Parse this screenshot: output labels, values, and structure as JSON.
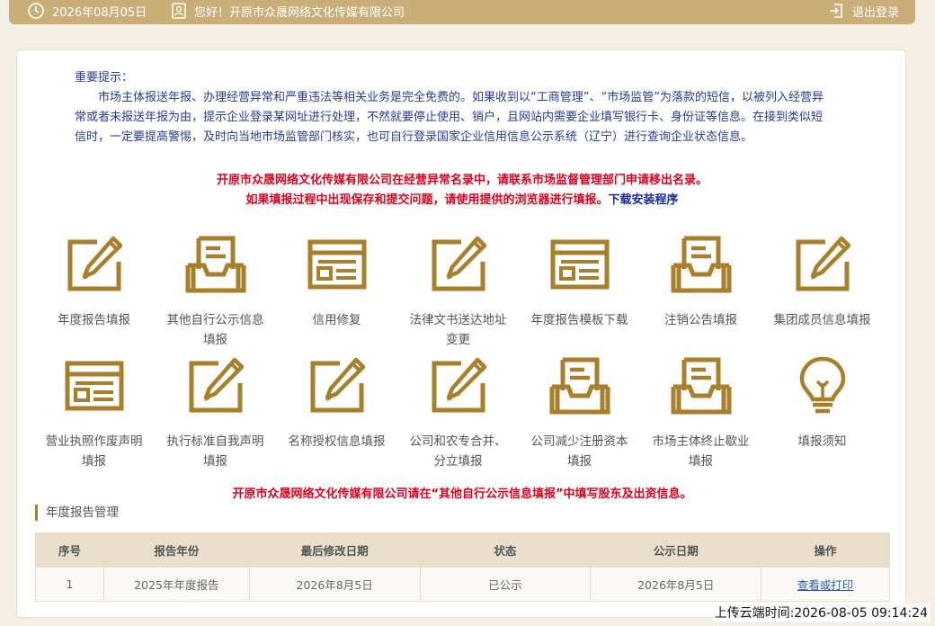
{
  "topbar": {
    "date": "2026年08月05日",
    "greeting": "您好！开原市众晟网络文化传媒有限公司",
    "logout": "退出登录"
  },
  "notice": {
    "heading": "重要提示：",
    "body": "市场主体报送年报、办理经营异常和严重违法等相关业务是完全免费的。如果收到以“工商管理”、“市场监管”为落款的短信，以被列入经营异常或者未报送年报为由，提示企业登录某网址进行处理，不然就要停止使用、销户，且网站内需要企业填写银行卡、身份证等信息。在接到类似短信时，一定要提高警惕，及时向当地市场监管部门核实，也可自行登录国家企业信用信息公示系统（辽宁）进行查询企业状态信息。"
  },
  "warnings": {
    "abnormal": "开原市众晟网络文化传媒有限公司在经营异常名录中，请联系市场监督管理部门申请移出名录。",
    "browser": "如果填报过程中出现保存和提交问题，请使用提供的浏览器进行填报。",
    "download_link": "下载安装程序",
    "shareholder": "开原市众晟网络文化传媒有限公司请在“其他自行公示信息填报”中填写股东及出资信息。"
  },
  "tiles": [
    {
      "icon": "edit-icon",
      "label": "年度报告填报"
    },
    {
      "icon": "inbox-icon",
      "label": "其他自行公示信息填报"
    },
    {
      "icon": "form-icon",
      "label": "信用修复"
    },
    {
      "icon": "edit-icon",
      "label": "法律文书送达地址变更"
    },
    {
      "icon": "form-icon",
      "label": "年度报告模板下载"
    },
    {
      "icon": "inbox-icon",
      "label": "注销公告填报"
    },
    {
      "icon": "edit-icon",
      "label": "集团成员信息填报"
    },
    {
      "icon": "form-icon",
      "label": "营业执照作废声明填报"
    },
    {
      "icon": "edit-icon",
      "label": "执行标准自我声明填报"
    },
    {
      "icon": "edit-icon",
      "label": "名称授权信息填报"
    },
    {
      "icon": "edit-icon",
      "label": "公司和农专合并、分立填报"
    },
    {
      "icon": "inbox-icon",
      "label": "公司减少注册资本填报"
    },
    {
      "icon": "inbox-icon",
      "label": "市场主体终止歇业填报"
    },
    {
      "icon": "lightbulb-icon",
      "label": "填报须知"
    }
  ],
  "section": {
    "title": "年度报告管理"
  },
  "table": {
    "headers": [
      "序号",
      "报告年份",
      "最后修改日期",
      "状态",
      "公示日期",
      "操作"
    ],
    "rows": [
      [
        "1",
        "2025年年度报告",
        "2026年8月5日",
        "已公示",
        "2026年8月5日",
        "查看或打印"
      ]
    ]
  },
  "upload_time": "上传云端时间:2026-08-05 09:14:24",
  "colors": {
    "accent": "#c9ae78",
    "icon": "#a87f2a",
    "notice_text": "#2a3a9e",
    "warning_text": "#e0001b"
  }
}
